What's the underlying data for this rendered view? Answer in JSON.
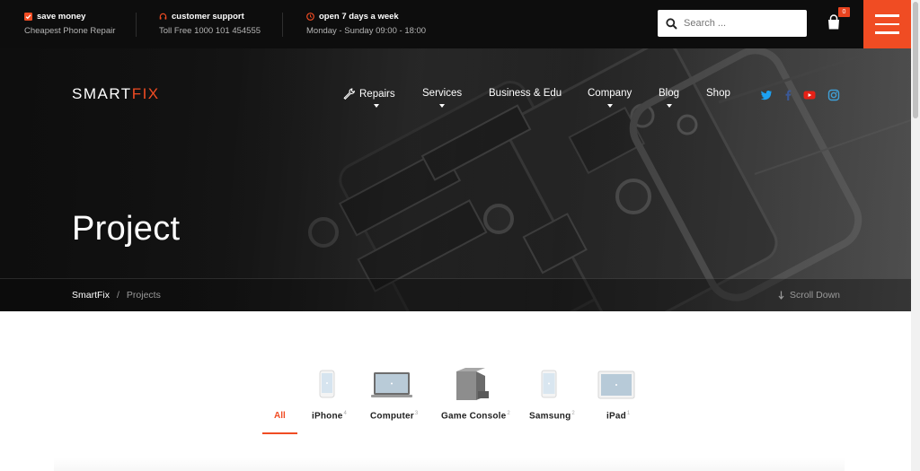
{
  "topbar": {
    "items": [
      {
        "title": "save money",
        "sub": "Cheapest Phone Repair",
        "icon": "check-square-icon"
      },
      {
        "title": "customer support",
        "sub": "Toll Free 1000 101 454555",
        "icon": "headset-icon"
      },
      {
        "title": "open 7 days a week",
        "sub": "Monday - Sunday 09:00 - 18:00",
        "icon": "clock-icon"
      }
    ],
    "search_placeholder": "Search ...",
    "cart_count": "0",
    "accent": "#f04c23"
  },
  "brand": {
    "logo_part1": "SMART",
    "logo_part2": "FIX"
  },
  "nav": [
    {
      "label": "Repairs",
      "has_caret": true
    },
    {
      "label": "Services",
      "has_caret": true
    },
    {
      "label": "Business & Edu",
      "has_caret": false
    },
    {
      "label": "Company",
      "has_caret": true
    },
    {
      "label": "Blog",
      "has_caret": true
    },
    {
      "label": "Shop",
      "has_caret": false
    }
  ],
  "social": [
    "twitter-icon",
    "facebook-icon",
    "youtube-icon",
    "instagram-icon"
  ],
  "hero": {
    "title": "Project"
  },
  "breadcrumb": {
    "home": "SmartFix",
    "separator": "/",
    "current": "Projects"
  },
  "scroll_down": "Scroll Down",
  "filters": [
    {
      "label": "All",
      "count": ""
    },
    {
      "label": "iPhone",
      "count": "4"
    },
    {
      "label": "Computer",
      "count": "3"
    },
    {
      "label": "Game Console",
      "count": "2"
    },
    {
      "label": "Samsung",
      "count": "2"
    },
    {
      "label": "iPad",
      "count": "1"
    }
  ]
}
